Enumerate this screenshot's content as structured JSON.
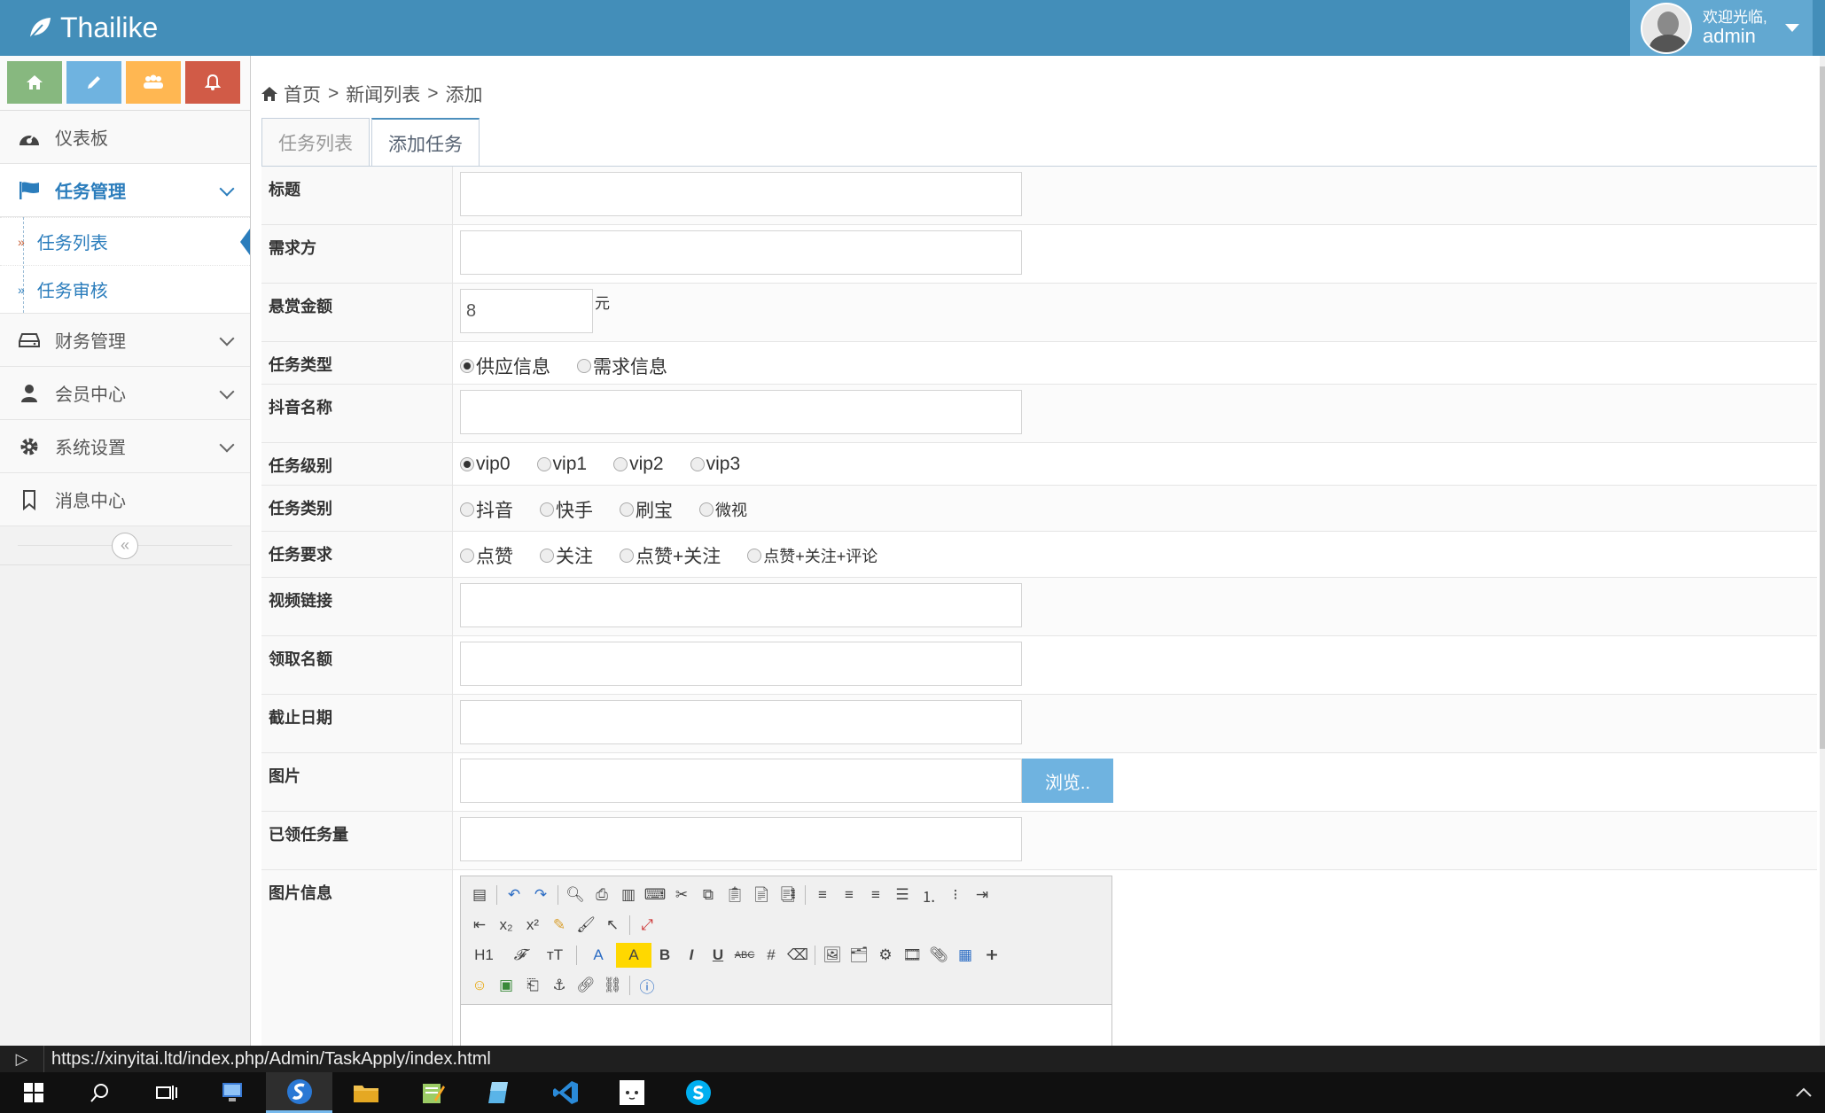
{
  "brand": {
    "name": "Thailike"
  },
  "user": {
    "welcome": "欢迎光临,",
    "name": "admin"
  },
  "sidebar": {
    "shortcuts": [
      {
        "icon": "home-icon",
        "color": "#87b87f"
      },
      {
        "icon": "pencil-icon",
        "color": "#6fb3e0"
      },
      {
        "icon": "users-icon",
        "color": "#ffb752"
      },
      {
        "icon": "bell-icon",
        "color": "#d15b47"
      }
    ],
    "dashboard": "仪表板",
    "task_mgmt": "任务管理",
    "task_list": "任务列表",
    "task_review": "任务审核",
    "finance": "财务管理",
    "members": "会员中心",
    "settings": "系统设置",
    "messages": "消息中心"
  },
  "breadcrumb": {
    "home": "首页",
    "news": "新闻列表",
    "current": "添加",
    "sep": ">"
  },
  "tabs": {
    "list": "任务列表",
    "add": "添加任务"
  },
  "form": {
    "title_label": "标题",
    "demand_label": "需求方",
    "reward_label": "悬赏金额",
    "reward_value": "8",
    "reward_unit": "元",
    "type_label": "任务类型",
    "type_options": [
      "供应信息",
      "需求信息"
    ],
    "douyin_label": "抖音名称",
    "level_label": "任务级别",
    "level_options": [
      "vip0",
      "vip1",
      "vip2",
      "vip3"
    ],
    "category_label": "任务类别",
    "category_options": [
      "抖音",
      "快手",
      "刷宝",
      "微视"
    ],
    "require_label": "任务要求",
    "require_options": [
      "点赞",
      "关注",
      "点赞+关注",
      "点赞+关注+评论"
    ],
    "video_label": "视频链接",
    "quota_label": "领取名额",
    "deadline_label": "截止日期",
    "image_label": "图片",
    "browse": "浏览..",
    "received_label": "已领任务量",
    "imginfo_label": "图片信息"
  },
  "editor": {
    "heading_btn": "H1",
    "bold": "B",
    "italic": "I",
    "underline": "U",
    "strike": "ABC"
  },
  "statusbar": {
    "url": "https://xinyitai.ltd/index.php/Admin/TaskApply/index.html"
  },
  "colors": {
    "navbar": "#438eb9",
    "accent": "#2b7dbc",
    "browse": "#6fb3e0"
  }
}
